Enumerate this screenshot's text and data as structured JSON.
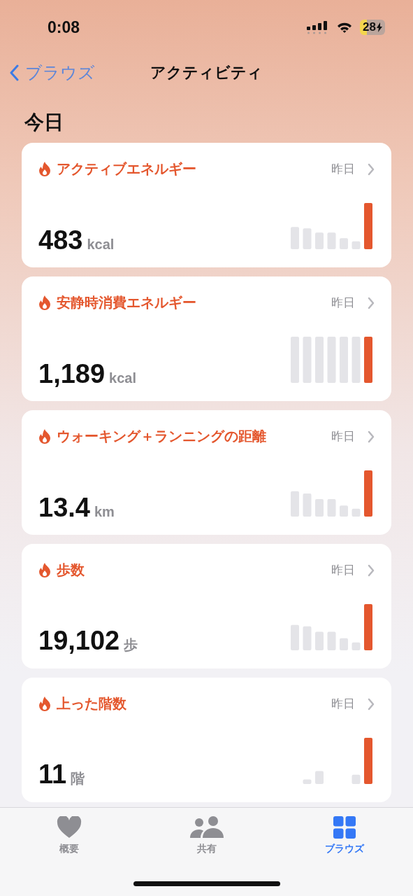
{
  "status_bar": {
    "time": "0:08",
    "battery": "28"
  },
  "nav": {
    "back": "ブラウズ",
    "title": "アクティビティ"
  },
  "section": "今日",
  "cards": [
    {
      "title": "アクティブエネルギー",
      "date": "昨日",
      "value": "483",
      "unit": "kcal"
    },
    {
      "title": "安静時消費エネルギー",
      "date": "昨日",
      "value": "1,189",
      "unit": "kcal"
    },
    {
      "title": "ウォーキング＋ランニングの距離",
      "date": "昨日",
      "value": "13.4",
      "unit": "km"
    },
    {
      "title": "歩数",
      "date": "昨日",
      "value": "19,102",
      "unit": "歩"
    },
    {
      "title": "上った階数",
      "date": "昨日",
      "value": "11",
      "unit": "階"
    }
  ],
  "tabs": [
    {
      "label": "概要",
      "selected": false
    },
    {
      "label": "共有",
      "selected": false
    },
    {
      "label": "ブラウズ",
      "selected": true
    }
  ]
}
